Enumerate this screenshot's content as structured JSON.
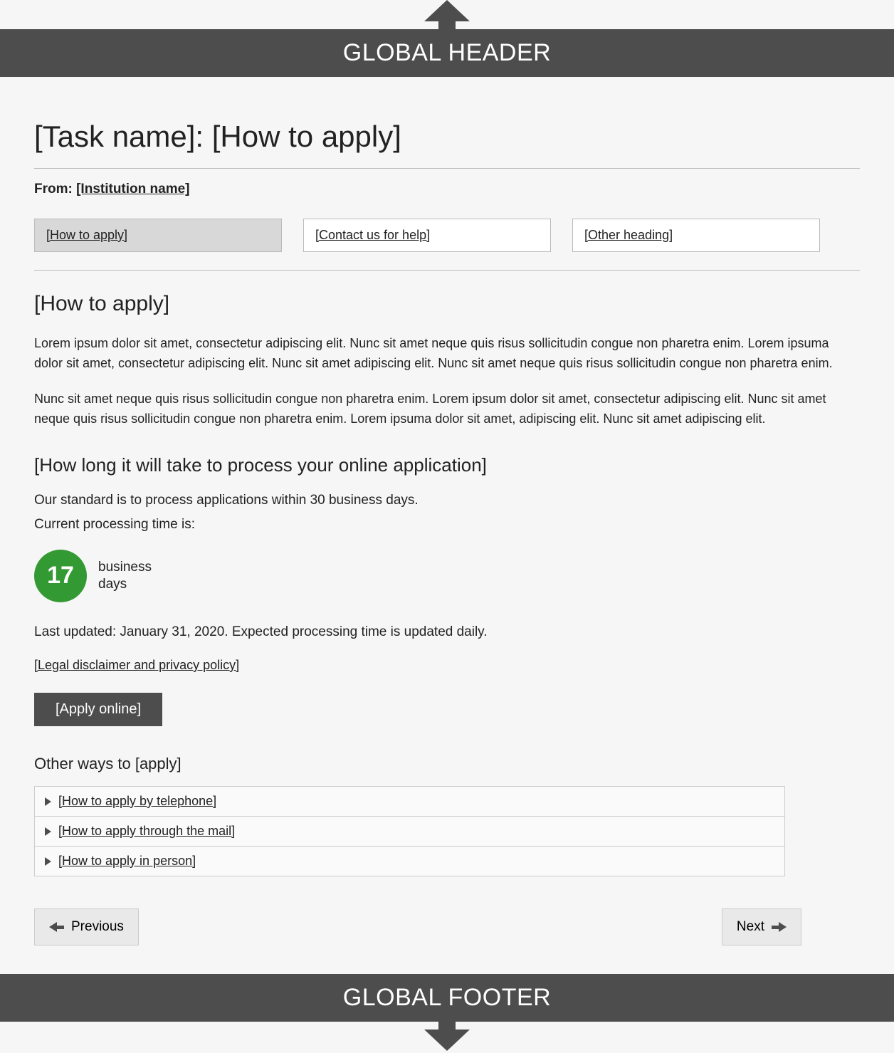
{
  "header": {
    "label": "GLOBAL HEADER"
  },
  "footer": {
    "label": "GLOBAL FOOTER"
  },
  "page": {
    "title": "[Task name]: [How to apply]",
    "from_label": "From:",
    "institution": "[Institution name]"
  },
  "subnav": {
    "items": [
      {
        "label": "[How to apply]",
        "active": true
      },
      {
        "label": "[Contact us for help]",
        "active": false
      },
      {
        "label": "[Other heading]",
        "active": false
      }
    ]
  },
  "section": {
    "heading": "[How to apply]",
    "para1": "Lorem ipsum dolor sit amet, consectetur adipiscing elit. Nunc sit amet neque quis  risus sollicitudin congue non pharetra enim. Lorem ipsuma dolor sit amet, consectetur adipiscing elit. Nunc sit amet adipiscing elit. Nunc sit amet neque quis risus sollicitudin congue non pharetra enim.",
    "para2": "Nunc sit amet neque quis risus sollicitudin congue non pharetra enim.  Lorem ipsum dolor sit amet, consectetur adipiscing elit. Nunc sit amet neque quis  risus sollicitudin congue non pharetra enim. Lorem ipsuma dolor sit amet, adipiscing elit. Nunc sit amet adipiscing elit."
  },
  "processing": {
    "heading": "[How long it will take to process your online application]",
    "standard": "Our standard is to process applications within 30 business days.",
    "current_label": "Current processing time is:",
    "days": "17",
    "unit_line1": "business",
    "unit_line2": "days",
    "last_updated": "Last updated: January 31, 2020. Expected processing time is updated daily."
  },
  "legal_link": "[Legal disclaimer and privacy policy]",
  "apply_button": "[Apply online]",
  "other_ways": {
    "heading": "Other ways to [apply]",
    "items": [
      "[How to apply by telephone]",
      "[How to apply through the mail]",
      "[How to apply in person]"
    ]
  },
  "pager": {
    "prev": "Previous",
    "next": "Next"
  }
}
